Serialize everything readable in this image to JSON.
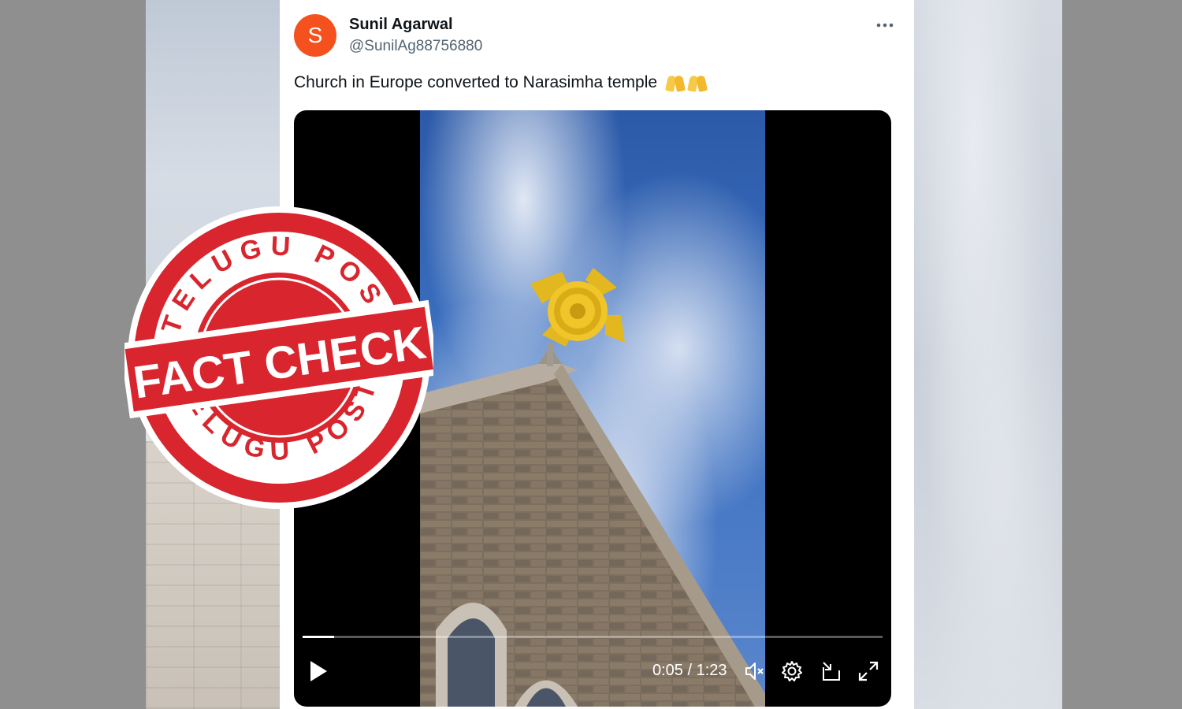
{
  "tweet": {
    "author_initial": "S",
    "author_name": "Sunil Agarwal",
    "author_handle": "@SunilAg88756880",
    "text": "Church in Europe converted to Narasimha temple",
    "emoji": [
      "folded-hands",
      "folded-hands"
    ]
  },
  "video": {
    "current_time": "0:05",
    "duration": "1:23",
    "time_display": "0:05 / 1:23",
    "progress_fraction": 0.055,
    "muted": true
  },
  "stamp": {
    "top_text": "TELUGU POST",
    "center_text": "FACT CHECK",
    "bottom_text": "TELUGU POST",
    "color": "#d9252d"
  },
  "colors": {
    "avatar_bg": "#f4511e",
    "text_primary": "#0f1419",
    "text_secondary": "#536471"
  }
}
